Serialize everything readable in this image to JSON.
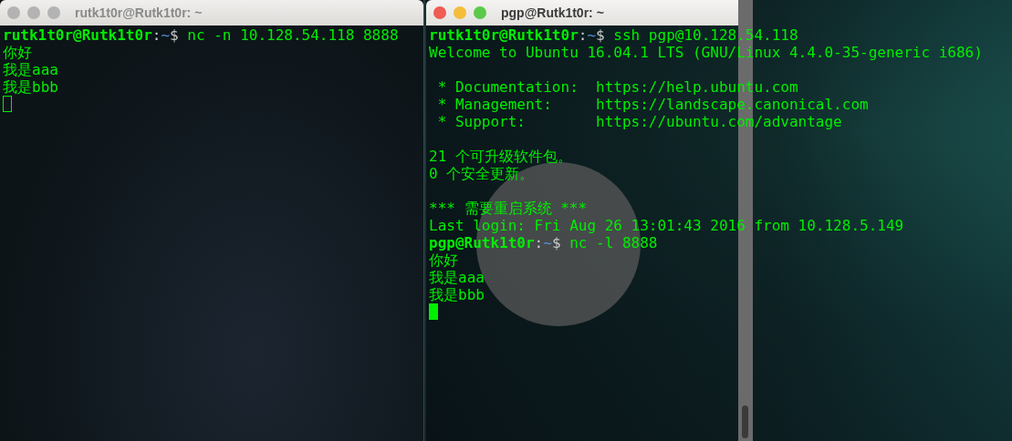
{
  "windows": [
    {
      "title": "rutk1t0r@Rutk1t0r: ~",
      "focused": false,
      "lines": [
        {
          "kind": "prompt",
          "user_host": "rutk1t0r@Rutk1t0r",
          "separator": ":",
          "path": "~",
          "prompt_sign": "$",
          "command": "nc -n 10.128.54.118 8888"
        },
        {
          "kind": "text",
          "text": "你好"
        },
        {
          "kind": "text",
          "text": "我是aaa"
        },
        {
          "kind": "text",
          "text": "我是bbb"
        },
        {
          "kind": "cursor"
        }
      ]
    },
    {
      "title": "pgp@Rutk1t0r: ~",
      "focused": true,
      "lines": [
        {
          "kind": "prompt",
          "user_host": "rutk1t0r@Rutk1t0r",
          "separator": ":",
          "path": "~",
          "prompt_sign": "$",
          "command": "ssh pgp@10.128.54.118"
        },
        {
          "kind": "text",
          "text": "Welcome to Ubuntu 16.04.1 LTS (GNU/Linux 4.4.0-35-generic i686)"
        },
        {
          "kind": "blank"
        },
        {
          "kind": "text",
          "text": " * Documentation:  https://help.ubuntu.com"
        },
        {
          "kind": "text",
          "text": " * Management:     https://landscape.canonical.com"
        },
        {
          "kind": "text",
          "text": " * Support:        https://ubuntu.com/advantage"
        },
        {
          "kind": "blank"
        },
        {
          "kind": "text",
          "text": "21 个可升级软件包。"
        },
        {
          "kind": "text",
          "text": "0 个安全更新。"
        },
        {
          "kind": "blank"
        },
        {
          "kind": "text",
          "text": "*** 需要重启系统 ***"
        },
        {
          "kind": "text",
          "text": "Last login: Fri Aug 26 13:01:43 2016 from 10.128.5.149"
        },
        {
          "kind": "prompt",
          "user_host": "pgp@Rutk1t0r",
          "separator": ":",
          "path": "~",
          "prompt_sign": "$",
          "command": "nc -l 8888"
        },
        {
          "kind": "text",
          "text": "你好"
        },
        {
          "kind": "text",
          "text": "我是aaa"
        },
        {
          "kind": "text",
          "text": "我是bbb"
        },
        {
          "kind": "cursor"
        }
      ]
    }
  ]
}
